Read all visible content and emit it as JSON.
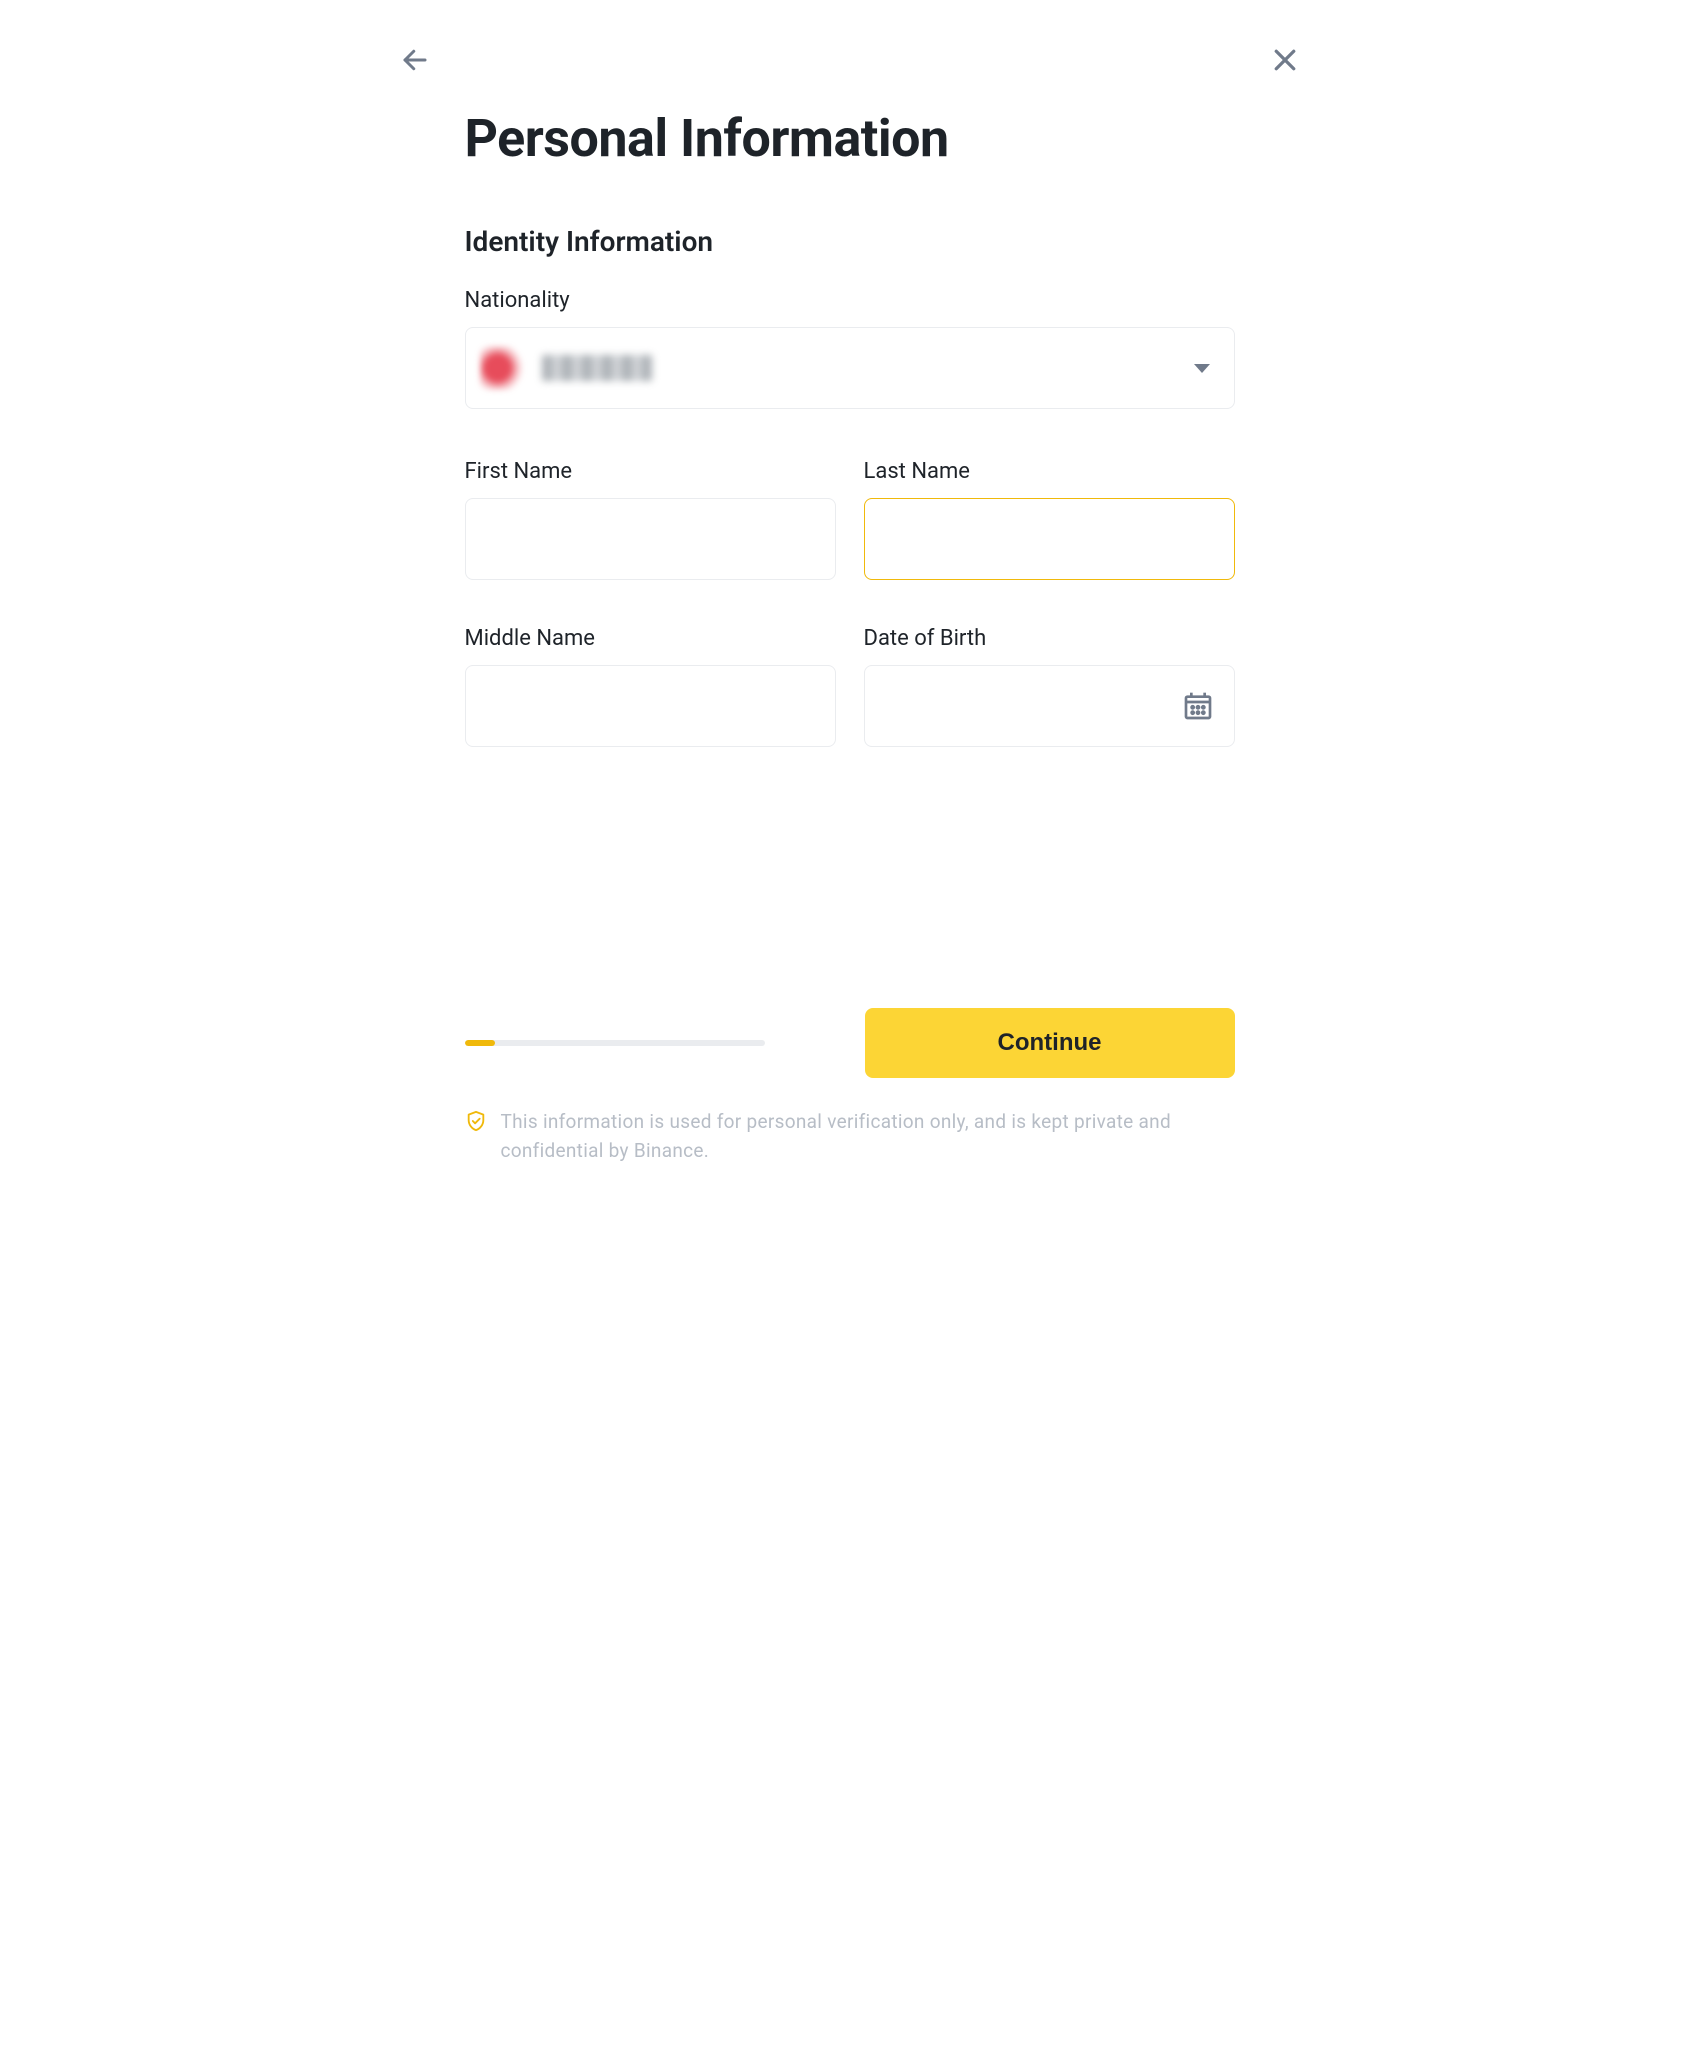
{
  "page": {
    "title": "Personal Information",
    "section_title": "Identity Information"
  },
  "labels": {
    "nationality": "Nationality",
    "first_name": "First Name",
    "last_name": "Last Name",
    "middle_name": "Middle Name",
    "dob": "Date of Birth"
  },
  "values": {
    "nationality": "",
    "first_name": "",
    "last_name": "",
    "middle_name": "",
    "dob": ""
  },
  "footer": {
    "continue_label": "Continue",
    "progress_percent": 10,
    "disclaimer": "This information is used for personal verification only, and is kept private and confidential by Binance."
  },
  "colors": {
    "accent": "#fcd535",
    "accent_border": "#f0b90b",
    "text": "#1e2329",
    "muted": "#b7bdc6",
    "border": "#eaecef"
  }
}
